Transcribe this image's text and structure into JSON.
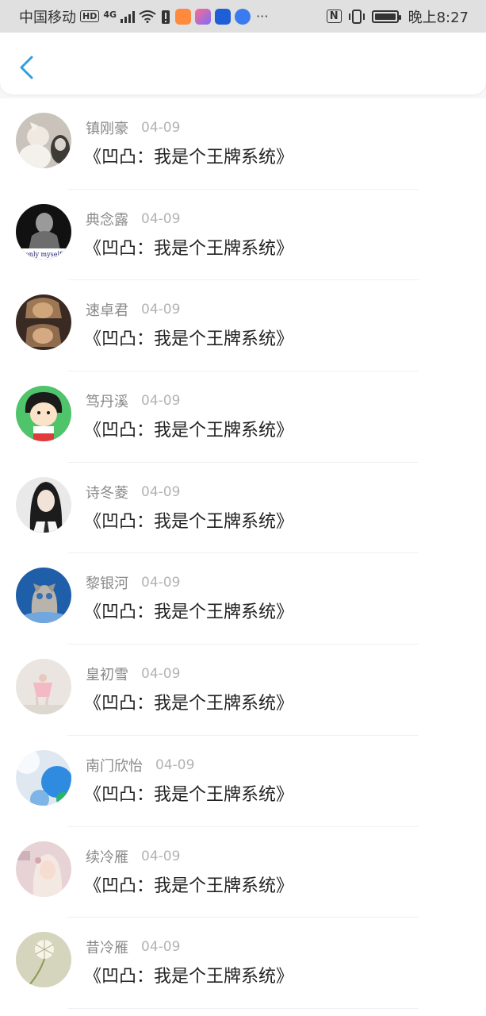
{
  "status_bar": {
    "carrier": "中国移动",
    "hd": "HD",
    "network": "4G",
    "time": "晚上8:27",
    "more": "···",
    "nfc": "N"
  },
  "header": {
    "back_icon": "chevron-left-icon",
    "accent": "#2d9fe0"
  },
  "items": [
    {
      "name": "镇刚豪",
      "date": "04-09",
      "title": "《凹凸：我是个王牌系统》",
      "avatar_bg": "#c9c3bb",
      "avatar_fg": "#efe9e2"
    },
    {
      "name": "典念露",
      "date": "04-09",
      "title": "《凹凸：我是个王牌系统》",
      "avatar_bg": "#111111",
      "avatar_fg": "#9a9a9a",
      "avatar_caption": "only myself"
    },
    {
      "name": "速卓君",
      "date": "04-09",
      "title": "《凹凸：我是个王牌系统》",
      "avatar_bg": "#3a2a24",
      "avatar_fg": "#e8c4a6"
    },
    {
      "name": "笃丹溪",
      "date": "04-09",
      "title": "《凹凸：我是个王牌系统》",
      "avatar_bg": "#4fc46a",
      "avatar_fg": "#fbe3c9"
    },
    {
      "name": "诗冬菱",
      "date": "04-09",
      "title": "《凹凸：我是个王牌系统》",
      "avatar_bg": "#e9e9e9",
      "avatar_fg": "#1c1c1c"
    },
    {
      "name": "黎银河",
      "date": "04-09",
      "title": "《凹凸：我是个王牌系统》",
      "avatar_bg": "#1f5ea8",
      "avatar_fg": "#b8b3ab"
    },
    {
      "name": "皇初雪",
      "date": "04-09",
      "title": "《凹凸：我是个王牌系统》",
      "avatar_bg": "#eae5e0",
      "avatar_fg": "#f3b9c4"
    },
    {
      "name": "南门欣怡",
      "date": "04-09",
      "title": "《凹凸：我是个王牌系统》",
      "avatar_bg": "#2e8be0",
      "avatar_fg": "#dfe8f1"
    },
    {
      "name": "续冷雁",
      "date": "04-09",
      "title": "《凹凸：我是个王牌系统》",
      "avatar_bg": "#e7d3d6",
      "avatar_fg": "#f4e8e2"
    },
    {
      "name": "昔冷雁",
      "date": "04-09",
      "title": "《凹凸：我是个王牌系统》",
      "avatar_bg": "#d5d5bd",
      "avatar_fg": "#f7f4e6"
    }
  ]
}
